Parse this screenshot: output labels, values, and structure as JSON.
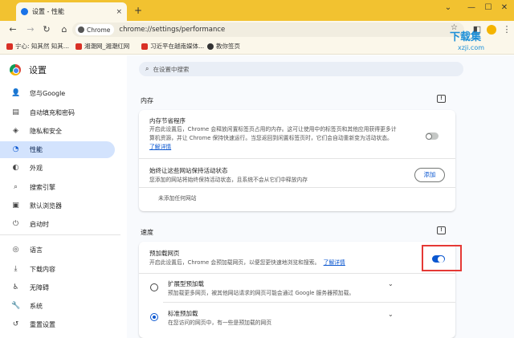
{
  "tab": {
    "title": "设置 - 性能",
    "close": "×"
  },
  "newtab": "+",
  "window": {
    "dropdown": "⌄",
    "minimize": "—",
    "maximize": "☐",
    "close": "✕"
  },
  "toolbar": {
    "back": "←",
    "forward": "→",
    "reload": "↻",
    "home": "⌂",
    "chip_label": "Chrome",
    "url": "chrome://settings/performance",
    "star": "☆",
    "side_panel": "◧",
    "menu": "⋮"
  },
  "bookmarks": [
    {
      "label": "宁心: 知其然 知其...",
      "color": "#d93025"
    },
    {
      "label": "湘潮网_湘潮红网",
      "color": "#d93025"
    },
    {
      "label": "习近平在越南媒体...",
      "color": "#d93025"
    },
    {
      "label": "教你签页",
      "color": "#333333"
    }
  ],
  "watermark": {
    "title": "下载集",
    "sub": "xzji.com"
  },
  "sidebar": {
    "title": "设置",
    "items": [
      {
        "label": "您与Google",
        "icon": "👤",
        "icon_name": "person-icon"
      },
      {
        "label": "自动填充和密码",
        "icon": "▤",
        "icon_name": "autofill-icon"
      },
      {
        "label": "隐私和安全",
        "icon": "◈",
        "icon_name": "shield-icon"
      },
      {
        "label": "性能",
        "icon": "◔",
        "icon_name": "speedometer-icon"
      },
      {
        "label": "外观",
        "icon": "◐",
        "icon_name": "palette-icon"
      },
      {
        "label": "搜索引擎",
        "icon": "⌕",
        "icon_name": "search-icon"
      },
      {
        "label": "默认浏览器",
        "icon": "▣",
        "icon_name": "browser-icon"
      },
      {
        "label": "启动时",
        "icon": "⏻",
        "icon_name": "power-icon"
      },
      {
        "label": "语言",
        "icon": "◎",
        "icon_name": "globe-icon"
      },
      {
        "label": "下载内容",
        "icon": "⤓",
        "icon_name": "download-icon"
      },
      {
        "label": "无障碍",
        "icon": "♿",
        "icon_name": "accessibility-icon"
      },
      {
        "label": "系统",
        "icon": "🔧",
        "icon_name": "wrench-icon"
      },
      {
        "label": "重置设置",
        "icon": "↺",
        "icon_name": "reset-icon"
      }
    ],
    "active_index": 3
  },
  "search": {
    "placeholder": "在设置中搜索"
  },
  "memory": {
    "heading": "内存",
    "saver_title": "内存节省程序",
    "saver_desc_1": "开启此设置后，Chrome 会释放闲置标签页占用的内存。这可让使用中的标签页和其他应用获得更多计",
    "saver_desc_2": "算机资源，并让 Chrome 保持快速运行。当您返回到闲置标签页时，它们会自动重新变为活动状态。",
    "saver_link": "了解详情",
    "saver_enabled": false,
    "keep_title": "始终让这些网站保持活动状态",
    "keep_desc": "您添加的网站将始终保持活动状态，且系统不会从它们中释放内存",
    "add_label": "添加",
    "empty_label": "未添加任何网站"
  },
  "speed": {
    "heading": "速度",
    "preload_title": "预加载网页",
    "preload_desc": "开启此设置后，Chrome 会预加载网页，以便您更快速地浏览和搜索。",
    "preload_link": "了解详情",
    "preload_enabled": true,
    "options": [
      {
        "title": "扩展型预加载",
        "desc": "预加载更多网页，被其他网站请求的网页可能会通过 Google 服务器预加载。",
        "checked": false
      },
      {
        "title": "标准预加载",
        "desc": "在您访问的网页中，有一些是预加载的网页",
        "checked": true
      }
    ],
    "chevron": "⌄"
  },
  "feedback_glyph": "!"
}
